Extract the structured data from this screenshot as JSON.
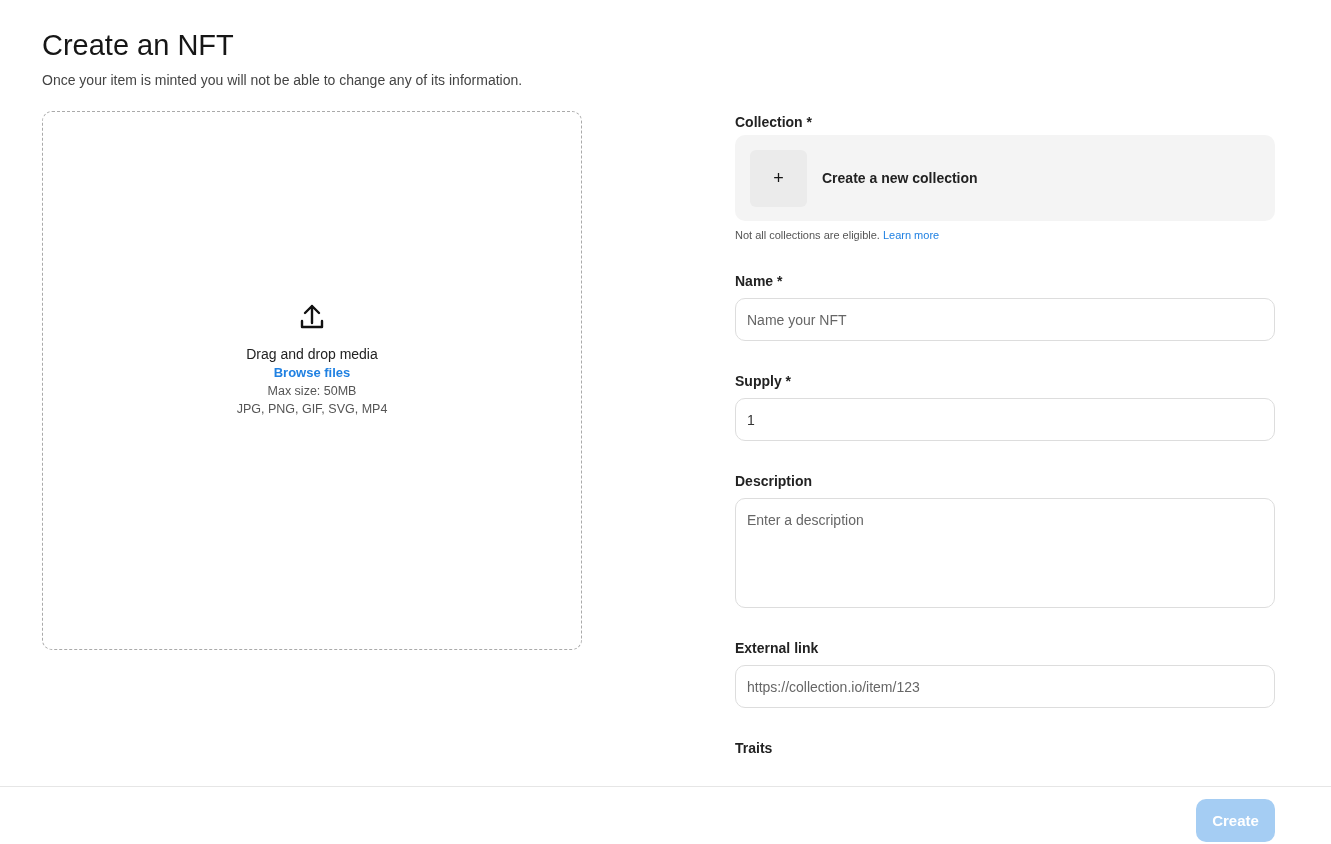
{
  "title": "Create an NFT",
  "subtitle": "Once your item is minted you will not be able to change any of its information.",
  "dropzone": {
    "heading": "Drag and drop media",
    "link": "Browse files",
    "max_size": "Max size: 50MB",
    "formats": "JPG, PNG, GIF, SVG, MP4"
  },
  "collection": {
    "label": "Collection *",
    "add_icon": "+",
    "action": "Create a new collection",
    "note": "Not all collections are eligible.",
    "note_link": "Learn more"
  },
  "fields": [
    {
      "kind": "text",
      "label": "Name *",
      "placeholder": "Name your NFT"
    },
    {
      "kind": "text",
      "label": "Supply *",
      "value": "1"
    },
    {
      "kind": "textarea",
      "label": "Description",
      "placeholder": "Enter a description"
    },
    {
      "kind": "text",
      "label": "External link",
      "placeholder": "https://collection.io/item/123"
    }
  ],
  "next_section": "Traits",
  "footer": {
    "button": {
      "label": "Create",
      "disabled": true
    }
  }
}
